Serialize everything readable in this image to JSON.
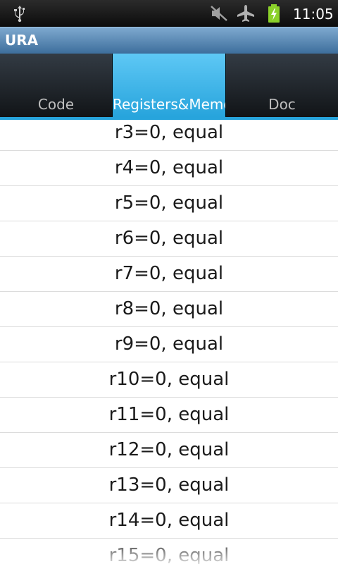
{
  "status_bar": {
    "time": "11:05",
    "icons": [
      "usb-icon",
      "mute-icon",
      "airplane-mode-icon",
      "battery-charging-icon"
    ],
    "battery_color": "#8bd12a"
  },
  "title_bar": {
    "title": "URA"
  },
  "tabs": [
    {
      "label": "Code",
      "selected": false
    },
    {
      "label": "Registers&Memory",
      "selected": true
    },
    {
      "label": "Doc",
      "selected": false
    }
  ],
  "accent_color": "#27a4dc",
  "registers": [
    "r3=0, equal",
    "r4=0, equal",
    "r5=0, equal",
    "r6=0, equal",
    "r7=0, equal",
    "r8=0, equal",
    "r9=0, equal",
    "r10=0, equal",
    "r11=0, equal",
    "r12=0, equal",
    "r13=0, equal",
    "r14=0, equal",
    "r15=0, equal"
  ]
}
